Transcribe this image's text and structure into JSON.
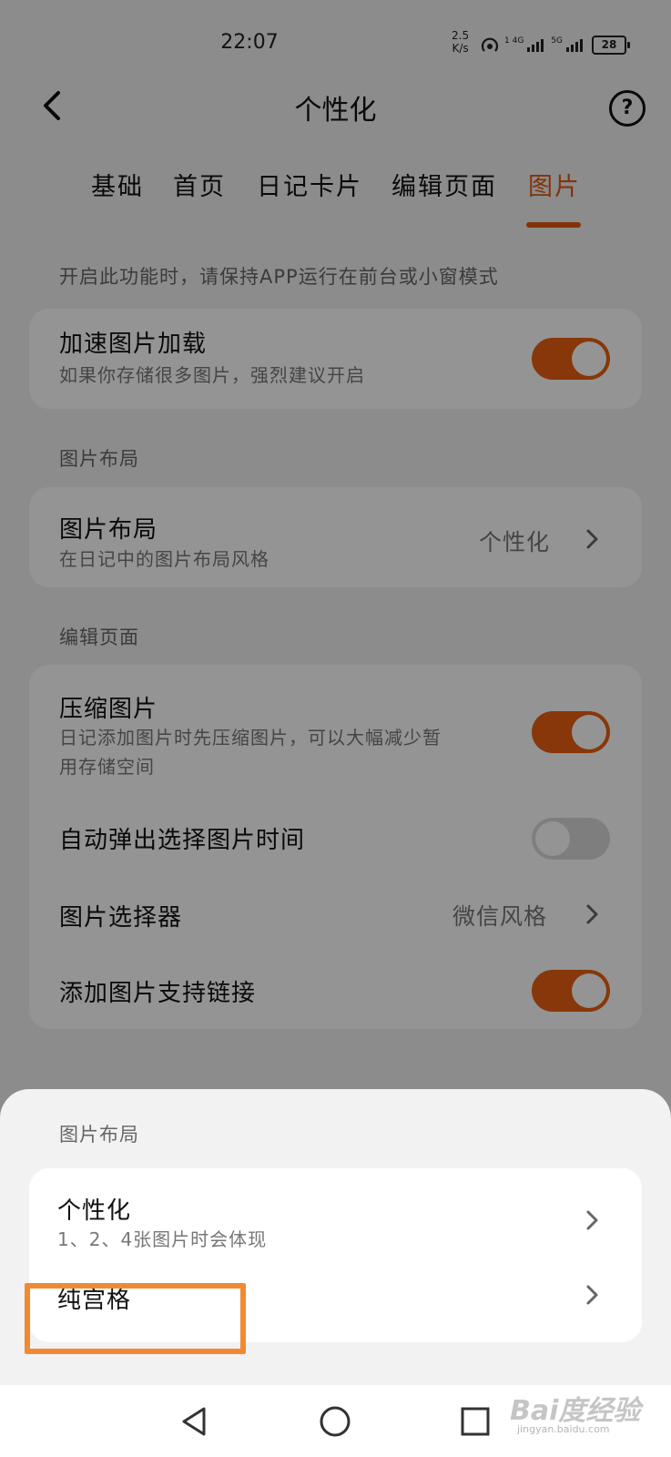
{
  "status_bar": {
    "time": "22:07",
    "net_speed_value": "2.5",
    "net_speed_unit": "K/s",
    "sim1_label": "1 4G",
    "sim2_label": "5G",
    "battery": "28"
  },
  "header": {
    "title": "个性化"
  },
  "tabs": [
    {
      "label": "基础"
    },
    {
      "label": "首页"
    },
    {
      "label": "日记卡片"
    },
    {
      "label": "编辑页面"
    },
    {
      "label": "图片",
      "active": true
    }
  ],
  "notice": "开启此功能时，请保持APP运行在前台或小窗模式",
  "speed_card": {
    "title": "加速图片加载",
    "subtitle": "如果你存储很多图片，强烈建议开启",
    "enabled": true
  },
  "layout_section": {
    "label": "图片布局",
    "row_title": "图片布局",
    "row_subtitle": "在日记中的图片布局风格",
    "row_value": "个性化"
  },
  "edit_section": {
    "label": "编辑页面",
    "compress": {
      "title": "压缩图片",
      "subtitle_line1": "日记添加图片时先压缩图片，可以大幅减少暂",
      "subtitle_line2": "用存储空间",
      "enabled": true
    },
    "auto_popup": {
      "title": "自动弹出选择图片时间",
      "enabled": false
    },
    "picker": {
      "title": "图片选择器",
      "value": "微信风格"
    },
    "link_support": {
      "title": "添加图片支持链接",
      "enabled": true
    }
  },
  "sheet": {
    "title": "图片布局",
    "options": [
      {
        "title": "个性化",
        "subtitle": "1、2、4张图片时会体现"
      },
      {
        "title": "纯宫格"
      }
    ]
  },
  "watermark": {
    "text": "Bai度经验",
    "url": "jingyan.baidu.com"
  },
  "colors": {
    "accent": "#e85f11",
    "highlight_box": "#f08a32"
  }
}
